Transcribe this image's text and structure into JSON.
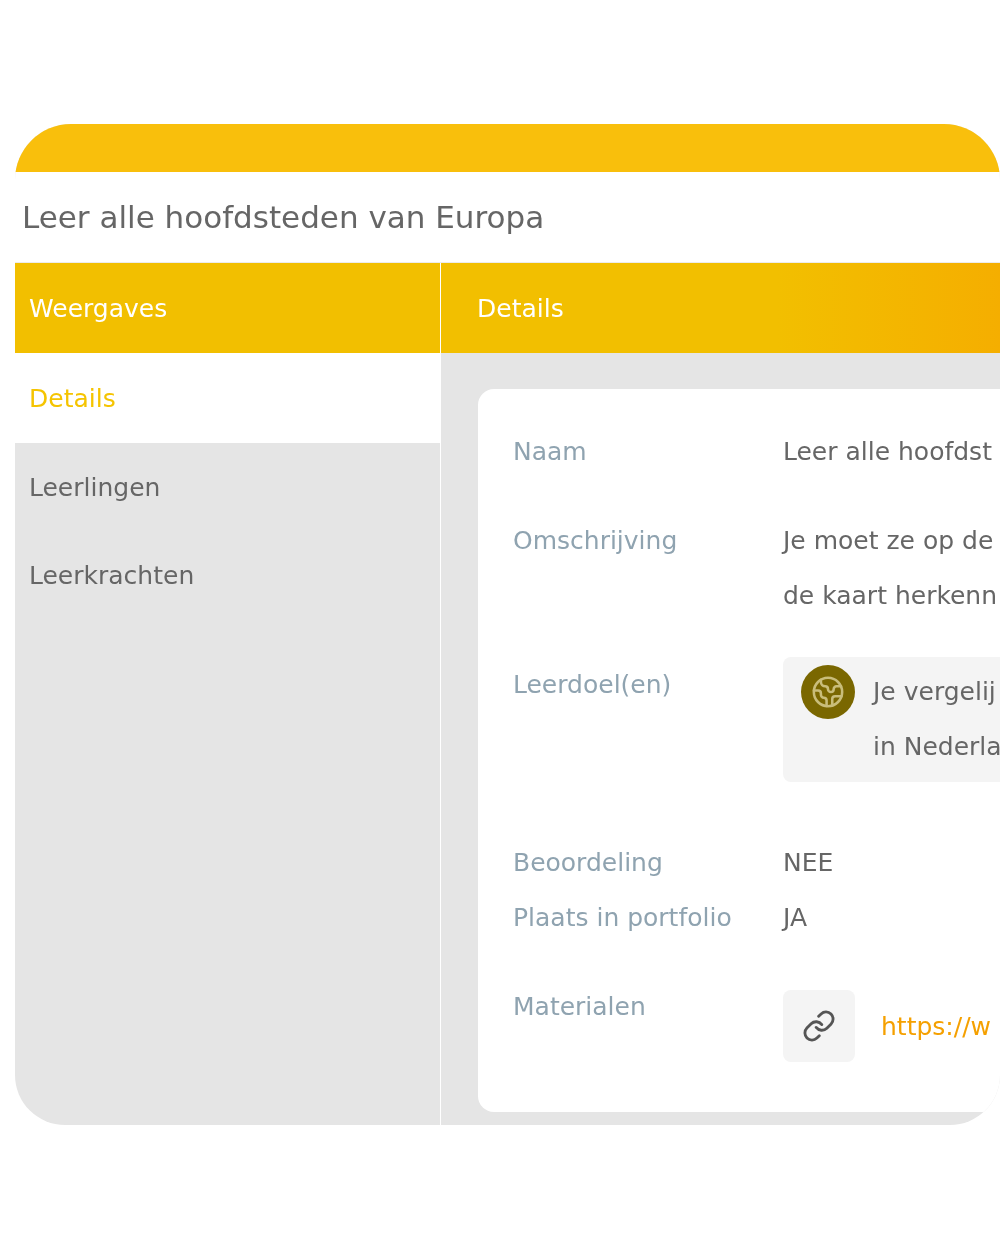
{
  "title": "Leer alle hoofdsteden van Europa",
  "sidebar": {
    "header": "Weergaves",
    "items": [
      {
        "label": "Details",
        "selected": true
      },
      {
        "label": "Leerlingen",
        "selected": false
      },
      {
        "label": "Leerkrachten",
        "selected": false
      }
    ]
  },
  "main": {
    "header": "Details",
    "fields": [
      {
        "kind": "text",
        "label": "Naam",
        "lines": [
          "Leer alle hoofdst"
        ]
      },
      {
        "kind": "text",
        "label": "Omschrijving",
        "lines": [
          "Je moet ze op de",
          "de kaart herkenn"
        ]
      },
      {
        "kind": "goal",
        "label": "Leerdoel(en)",
        "lines": [
          "Je vergelij",
          "in Nederla"
        ]
      },
      {
        "kind": "flag",
        "label": "Beoordeling",
        "lines": [
          "NEE"
        ]
      },
      {
        "kind": "flag",
        "label": "Plaats in portfolio",
        "lines": [
          "JA"
        ]
      },
      {
        "kind": "link",
        "label": "Materialen",
        "lines": [
          "https://w"
        ]
      }
    ]
  }
}
